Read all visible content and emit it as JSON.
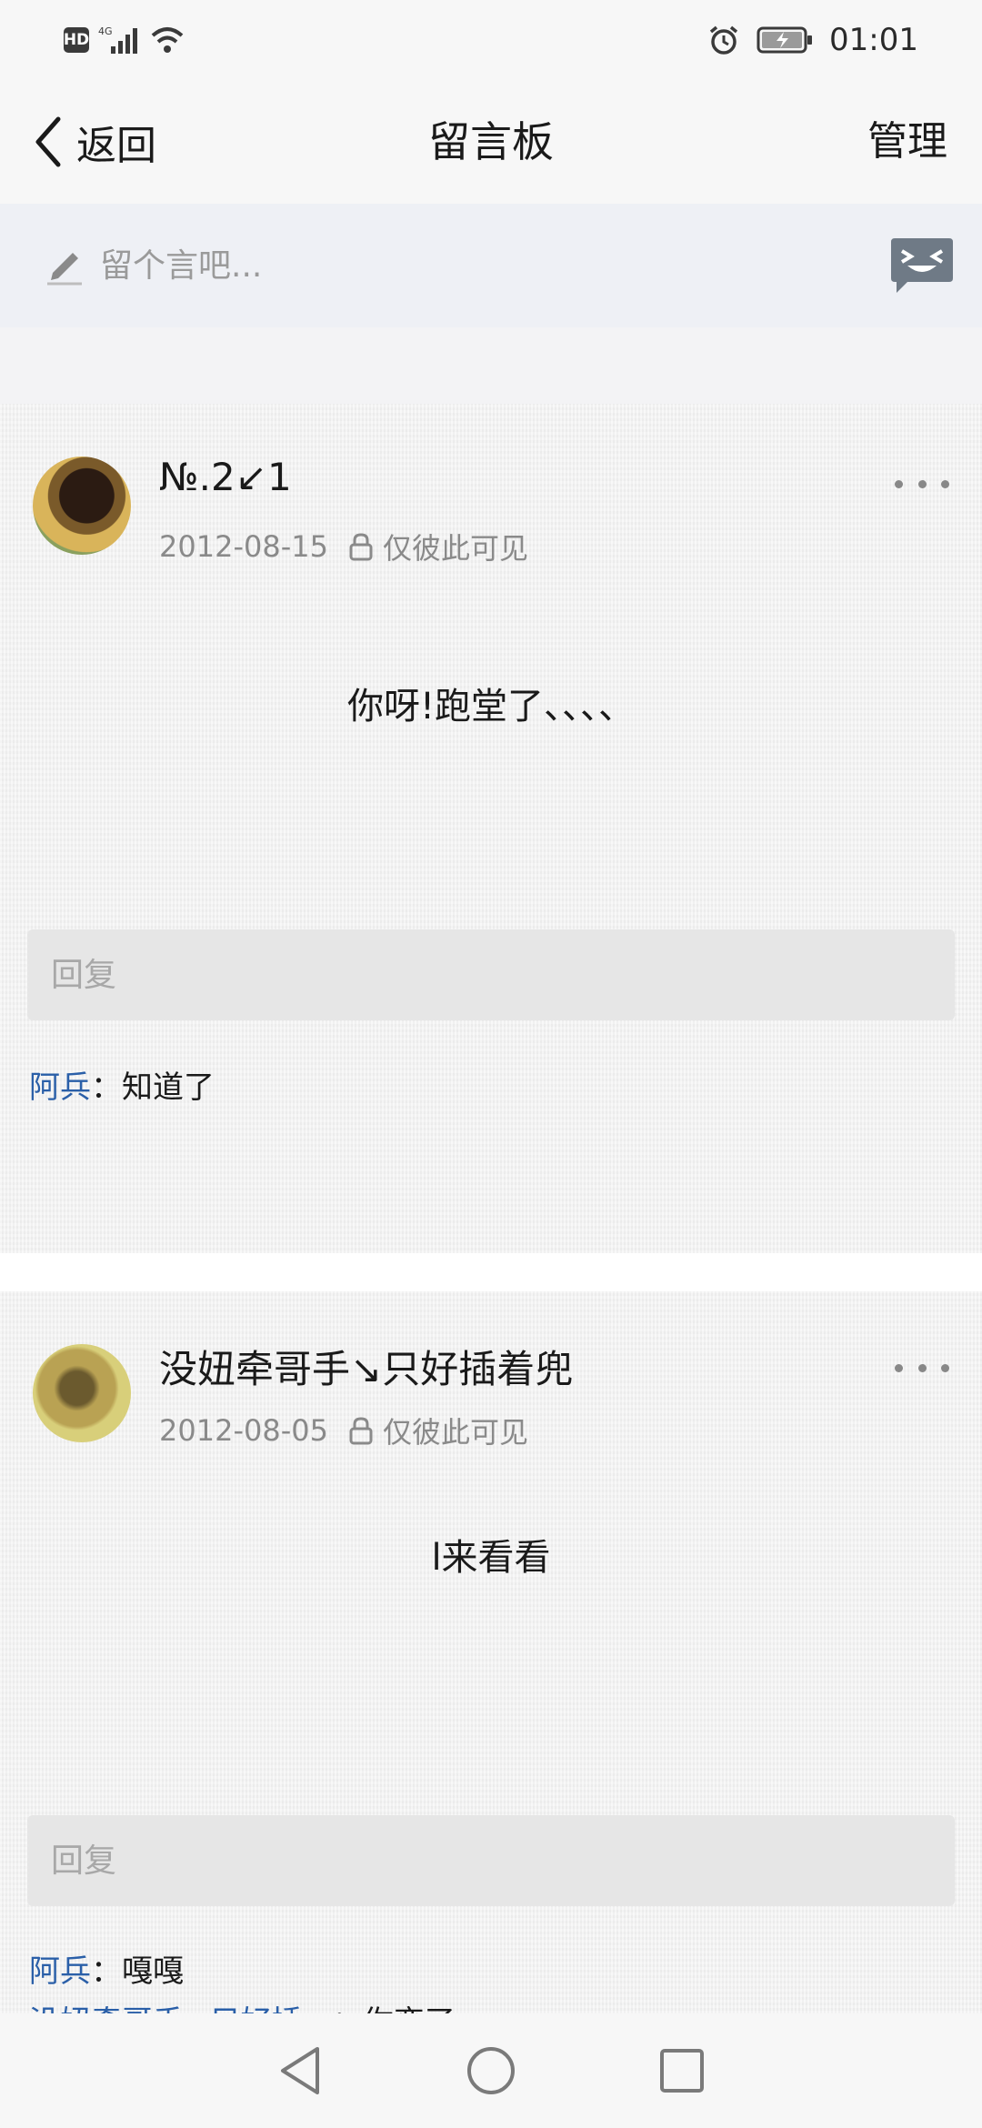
{
  "status_bar": {
    "hd_label": "HD",
    "network_label": "4G",
    "time": "01:01",
    "icons": [
      "hd-icon",
      "signal-icon",
      "wifi-icon",
      "alarm-icon",
      "battery-charging-icon"
    ]
  },
  "nav": {
    "back_label": "返回",
    "title": "留言板",
    "manage_label": "管理"
  },
  "compose": {
    "placeholder": "留个言吧...",
    "pencil_icon": "pencil-icon",
    "emoji_icon": "emoji-icon"
  },
  "messages": [
    {
      "author": "№.2↙1",
      "date": "2012-08-15",
      "privacy": "仅彼此可见",
      "content": "你呀!跑堂了、、、、",
      "reply_placeholder": "回复",
      "replies": [
        {
          "author": "阿兵",
          "separator": "：",
          "text": "知道了"
        }
      ]
    },
    {
      "author": "没妞牵哥手↘只好插着兜",
      "date": "2012-08-05",
      "privacy": "仅彼此可见",
      "content": "l来看看",
      "reply_placeholder": "回复",
      "replies": [
        {
          "author": "阿兵",
          "separator": "：",
          "text": "嘎嘎"
        },
        {
          "author": "没妞牵哥手↘只好插...",
          "separator": "：",
          "text": "你变了"
        }
      ]
    }
  ],
  "colors": {
    "link_blue": "#2a5fa8",
    "bar_bg": "#f7f7f7",
    "compose_bg": "#eef0f5"
  }
}
